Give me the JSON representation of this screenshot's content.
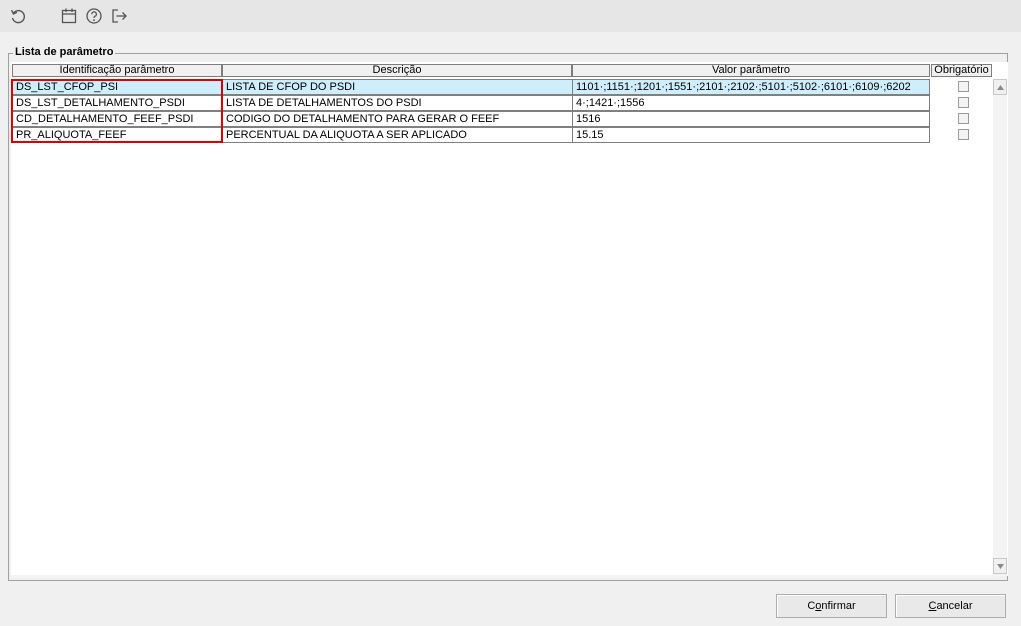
{
  "toolbar": {
    "icons": [
      "refresh-icon",
      "calendar-icon",
      "help-icon",
      "exit-icon"
    ]
  },
  "group": {
    "title": "Lista de parâmetro"
  },
  "grid": {
    "columns": [
      "Identificação parâmetro",
      "Descrição",
      "Valor parâmetro",
      "Obrigatório"
    ],
    "rows": [
      {
        "id": "DS_LST_CFOP_PSI",
        "description": "LISTA DE CFOP DO PSDI",
        "value": "1101·;1151·;1201·;1551·;2101·;2102·;5101·;5102·;6101·;6109·;6202",
        "required": false
      },
      {
        "id": "DS_LST_DETALHAMENTO_PSDI",
        "description": "LISTA DE DETALHAMENTOS DO PSDI",
        "value": "4·;1421·;1556",
        "required": false
      },
      {
        "id": "CD_DETALHAMENTO_FEEF_PSDI",
        "description": "CODIGO DO DETALHAMENTO PARA GERAR O FEEF",
        "value": "1516",
        "required": false
      },
      {
        "id": "PR_ALIQUOTA_FEEF",
        "description": "PERCENTUAL DA ALIQUOTA A SER APLICADO",
        "value": "15.15",
        "required": false
      }
    ],
    "selected_row": 0
  },
  "buttons": {
    "confirm_first": "C",
    "confirm_ul": "o",
    "confirm_rest": "nfirmar",
    "cancel_ul": "C",
    "cancel_rest": "ancelar"
  },
  "colors": {
    "selected_row": "#cdeefa",
    "highlight_border": "#e00000"
  }
}
